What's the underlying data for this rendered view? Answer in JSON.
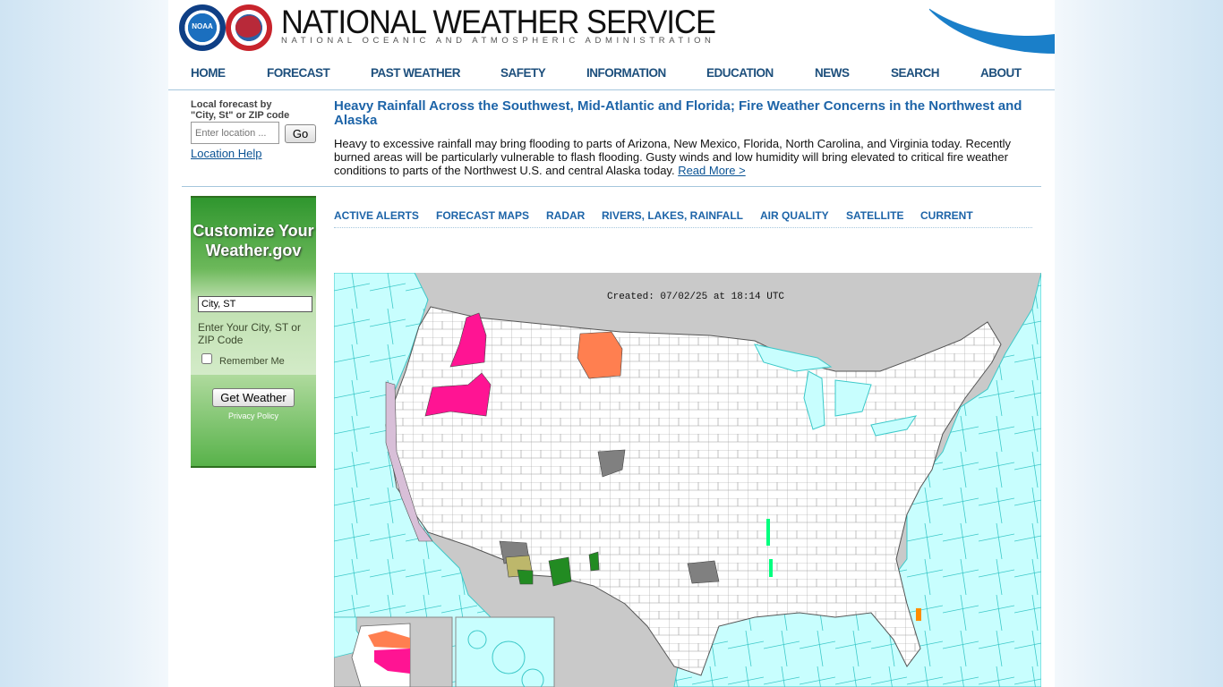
{
  "header": {
    "title": "NATIONAL WEATHER SERVICE",
    "subtitle": "NATIONAL OCEANIC AND ATMOSPHERIC ADMINISTRATION",
    "noaa_logo_text": "NOAA"
  },
  "nav": {
    "items": [
      "HOME",
      "FORECAST",
      "PAST WEATHER",
      "SAFETY",
      "INFORMATION",
      "EDUCATION",
      "NEWS",
      "SEARCH",
      "ABOUT"
    ]
  },
  "local_forecast": {
    "label_line1": "Local forecast by",
    "label_line2": "\"City, St\" or ZIP code",
    "placeholder": "Enter location ...",
    "go_label": "Go",
    "help_link": "Location Help"
  },
  "news": {
    "headline": "Heavy Rainfall Across the Southwest, Mid-Atlantic and Florida; Fire Weather Concerns in the Northwest and Alaska",
    "body": "Heavy to excessive rainfall may bring flooding to parts of Arizona, New Mexico, Florida, North Carolina, and Virginia today. Recently burned areas will be particularly vulnerable to flash flooding. Gusty winds and low humidity will bring elevated to critical fire weather conditions to parts of the Northwest U.S. and central Alaska today. ",
    "read_more": "Read More >"
  },
  "customize": {
    "title": "Customize Your Weather.gov",
    "input_value": "City, ST",
    "hint": "Enter Your City, ST or ZIP Code",
    "remember": "Remember Me",
    "button": "Get Weather",
    "privacy": "Privacy Policy"
  },
  "map_tabs": [
    "ACTIVE ALERTS",
    "FORECAST MAPS",
    "RADAR",
    "RIVERS, LAKES, RAINFALL",
    "AIR QUALITY",
    "SATELLITE",
    "CURRENT"
  ],
  "map": {
    "created": "Created: 07/02/25 at 18:14 UTC",
    "colors": {
      "ocean": "#c8fefe",
      "land": "#ffffff",
      "foreign": "#c9c9c9",
      "red_flag_warning": "#ff1493",
      "fire_weather_watch": "#ff7f50",
      "flood_advisory": "#00ff7f",
      "flash_flood_warning": "#228b22",
      "dust_advisory": "#bdb76b",
      "heat_advisory": "#808080",
      "coastal": "#d8bfd8"
    }
  }
}
